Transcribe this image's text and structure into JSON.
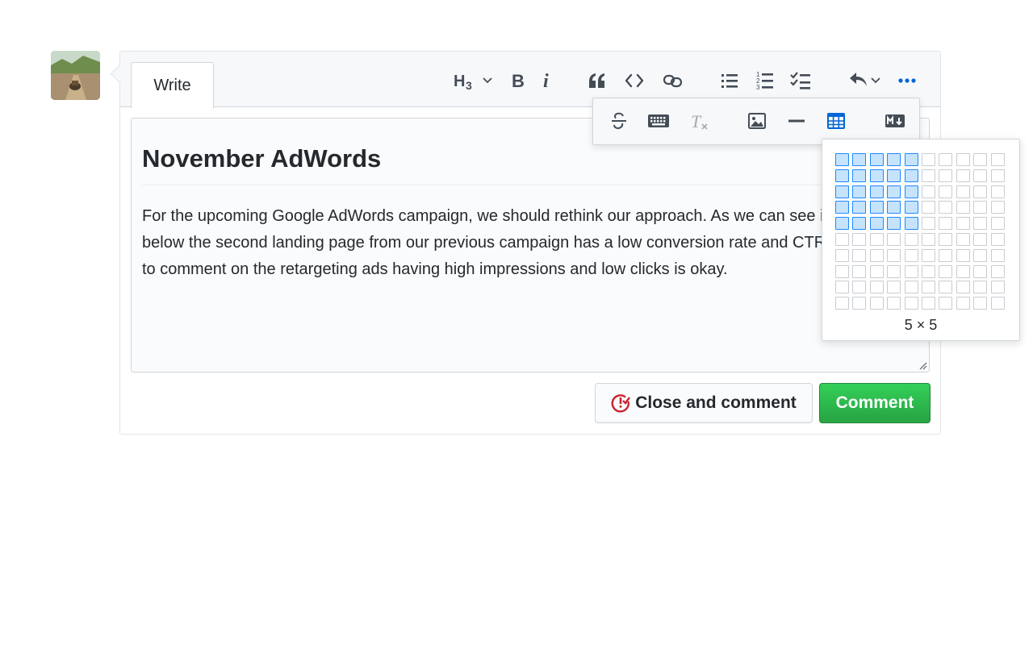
{
  "tabs": {
    "write": "Write"
  },
  "toolbar": {
    "heading": "H3",
    "bold": "B",
    "italic": "i"
  },
  "editor": {
    "heading": "November AdWords",
    "body": "For the upcoming Google AdWords campaign, we should rethink our approach. As we can see in the table below the second landing page from our previous campaign has a low conversion rate and CTR. Also, just to comment on the retargeting ads having high impressions and low clicks is okay."
  },
  "buttons": {
    "close_and_comment": "Close and comment",
    "comment": "Comment"
  },
  "table_picker": {
    "rows": 10,
    "cols": 10,
    "selected_rows": 5,
    "selected_cols": 5,
    "label": "5 × 5"
  },
  "colors": {
    "accent": "#0366d6",
    "danger": "#cb2431",
    "success": "#28a745",
    "grid_selected": "#c5e3fb"
  },
  "icons": [
    "heading-icon",
    "chevron-down-icon",
    "bold-icon",
    "italic-icon",
    "quote-icon",
    "code-icon",
    "link-icon",
    "unordered-list-icon",
    "ordered-list-icon",
    "task-list-icon",
    "reply-icon",
    "ellipsis-icon",
    "strikethrough-icon",
    "keyboard-icon",
    "clear-format-icon",
    "image-icon",
    "horizontal-rule-icon",
    "table-icon",
    "markdown-icon",
    "issue-closed-icon",
    "resize-handle-icon"
  ]
}
